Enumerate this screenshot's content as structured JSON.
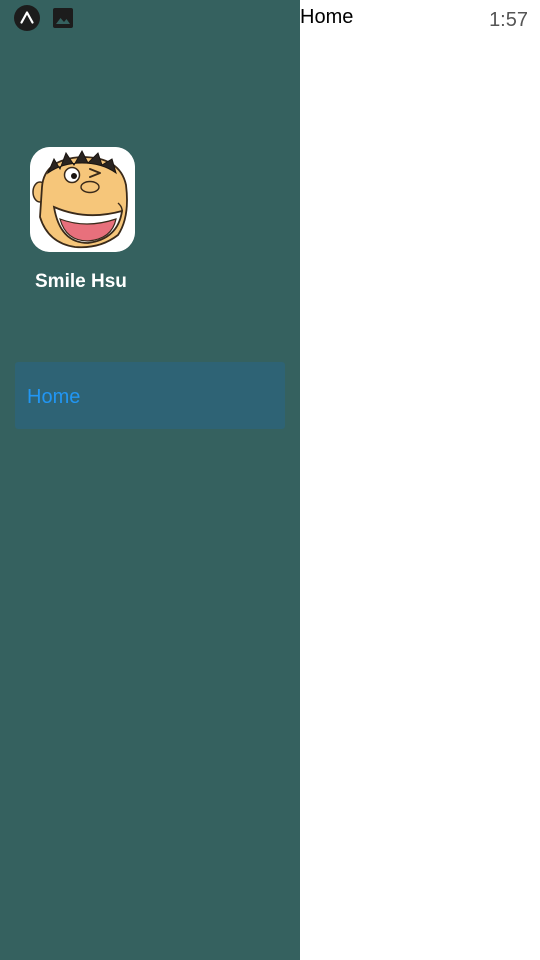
{
  "status_bar": {
    "time": "1:57",
    "icons": [
      "expo-app-icon",
      "image-icon"
    ]
  },
  "drawer": {
    "background": "#35615f",
    "user": {
      "name": "Smile Hsu",
      "avatar": "cartoon-boy-winking-avatar"
    },
    "items": [
      {
        "label": "Home",
        "active": true
      }
    ],
    "active_color": "#2196f3",
    "active_background": "#2e6375"
  },
  "main": {
    "title": "Home"
  }
}
